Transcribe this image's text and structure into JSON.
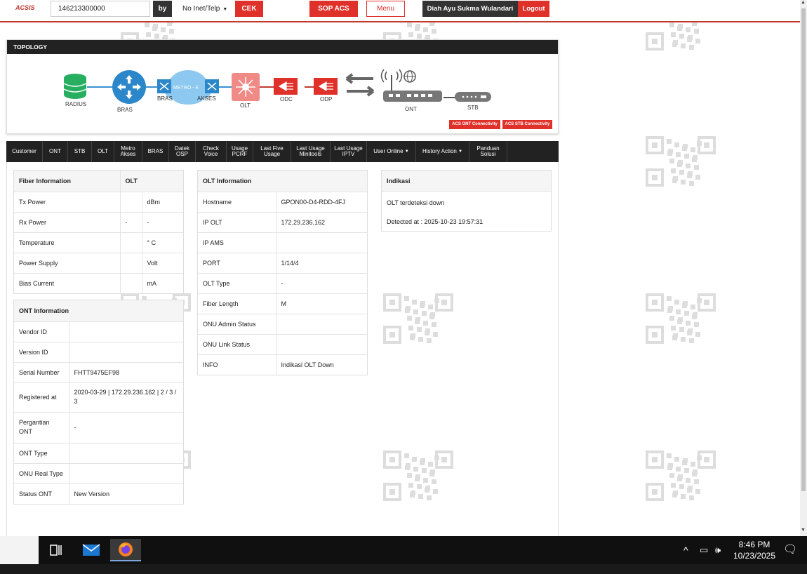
{
  "header": {
    "logo": "ACSIS",
    "search_value": "146213300000",
    "by_label": "by",
    "search_type": "No Inet/Telp",
    "cek_label": "CEK",
    "sop_label": "SOP ACS",
    "menu_label": "Menu",
    "user_name": "Diah Ayu Sukma Wulandari",
    "logout_label": "Logout"
  },
  "topology": {
    "title": "TOPOLOGY",
    "nodes": [
      "RADIUS",
      "BRAS",
      "BRAS",
      "METRO - E",
      "AKSES",
      "OLT",
      "ODC",
      "ODP",
      "ONT",
      "STB"
    ],
    "acs_ont_label": "ACS ONT Connectivity",
    "acs_stb_label": "ACS STB Connectivity"
  },
  "nav": [
    "Customer",
    "ONT",
    "STB",
    "OLT",
    "Metro Akses",
    "BRAS",
    "Datek OSP",
    "Check Voice",
    "Usage PCRF",
    "Last Five Usage",
    "Last Usage Minitools",
    "Last Usage IPTV",
    "User Online",
    "History Action",
    "Panduan Solusi"
  ],
  "fiber": {
    "title": "Fiber Information",
    "col2": "OLT",
    "rows": [
      {
        "label": "Tx Power",
        "value": "",
        "unit": "dBm"
      },
      {
        "label": "Rx Power",
        "value": "-",
        "unit": "-"
      },
      {
        "label": "Temperature",
        "value": "",
        "unit": "° C"
      },
      {
        "label": "Power Supply",
        "value": "",
        "unit": "Volt"
      },
      {
        "label": "Bias Current",
        "value": "",
        "unit": "mA"
      }
    ]
  },
  "ont_info": {
    "title": "ONT Information",
    "rows": [
      {
        "label": "Vendor ID",
        "value": ""
      },
      {
        "label": "Version ID",
        "value": ""
      },
      {
        "label": "Serial Number",
        "value": "FHTT9475EF98"
      },
      {
        "label": "Registered at",
        "value": "2020-03-29 | 172.29.236.162 | 2 / 3 / 3"
      },
      {
        "label": "Pergantian ONT",
        "value": "-"
      },
      {
        "label": "ONT Type",
        "value": ""
      },
      {
        "label": "ONU Real Type",
        "value": ""
      },
      {
        "label": "Status ONT",
        "value": "New Version"
      }
    ]
  },
  "olt_info": {
    "title": "OLT Information",
    "rows": [
      {
        "label": "Hostname",
        "value": "GPON00-D4-RDD-4FJ"
      },
      {
        "label": "IP OLT",
        "value": "172.29.236.162"
      },
      {
        "label": "IP AMS",
        "value": ""
      },
      {
        "label": "PORT",
        "value": "1/14/4"
      },
      {
        "label": "OLT Type",
        "value": "-"
      },
      {
        "label": "Fiber Length",
        "value": "M"
      },
      {
        "label": "ONU Admin Status",
        "value": ""
      },
      {
        "label": "ONU Link Status",
        "value": ""
      },
      {
        "label": "INFO",
        "value": "Indikasi OLT Down"
      }
    ]
  },
  "indikasi": {
    "title": "Indikasi",
    "status": "OLT terdeteksi down",
    "detected_prefix": "Detected at : ",
    "detected_at": "2025-10-23 19:57:31"
  },
  "taskbar": {
    "time": "8:46 PM",
    "date": "10/23/2025"
  },
  "colors": {
    "accent_red": "#e0302a",
    "dark": "#222222"
  }
}
